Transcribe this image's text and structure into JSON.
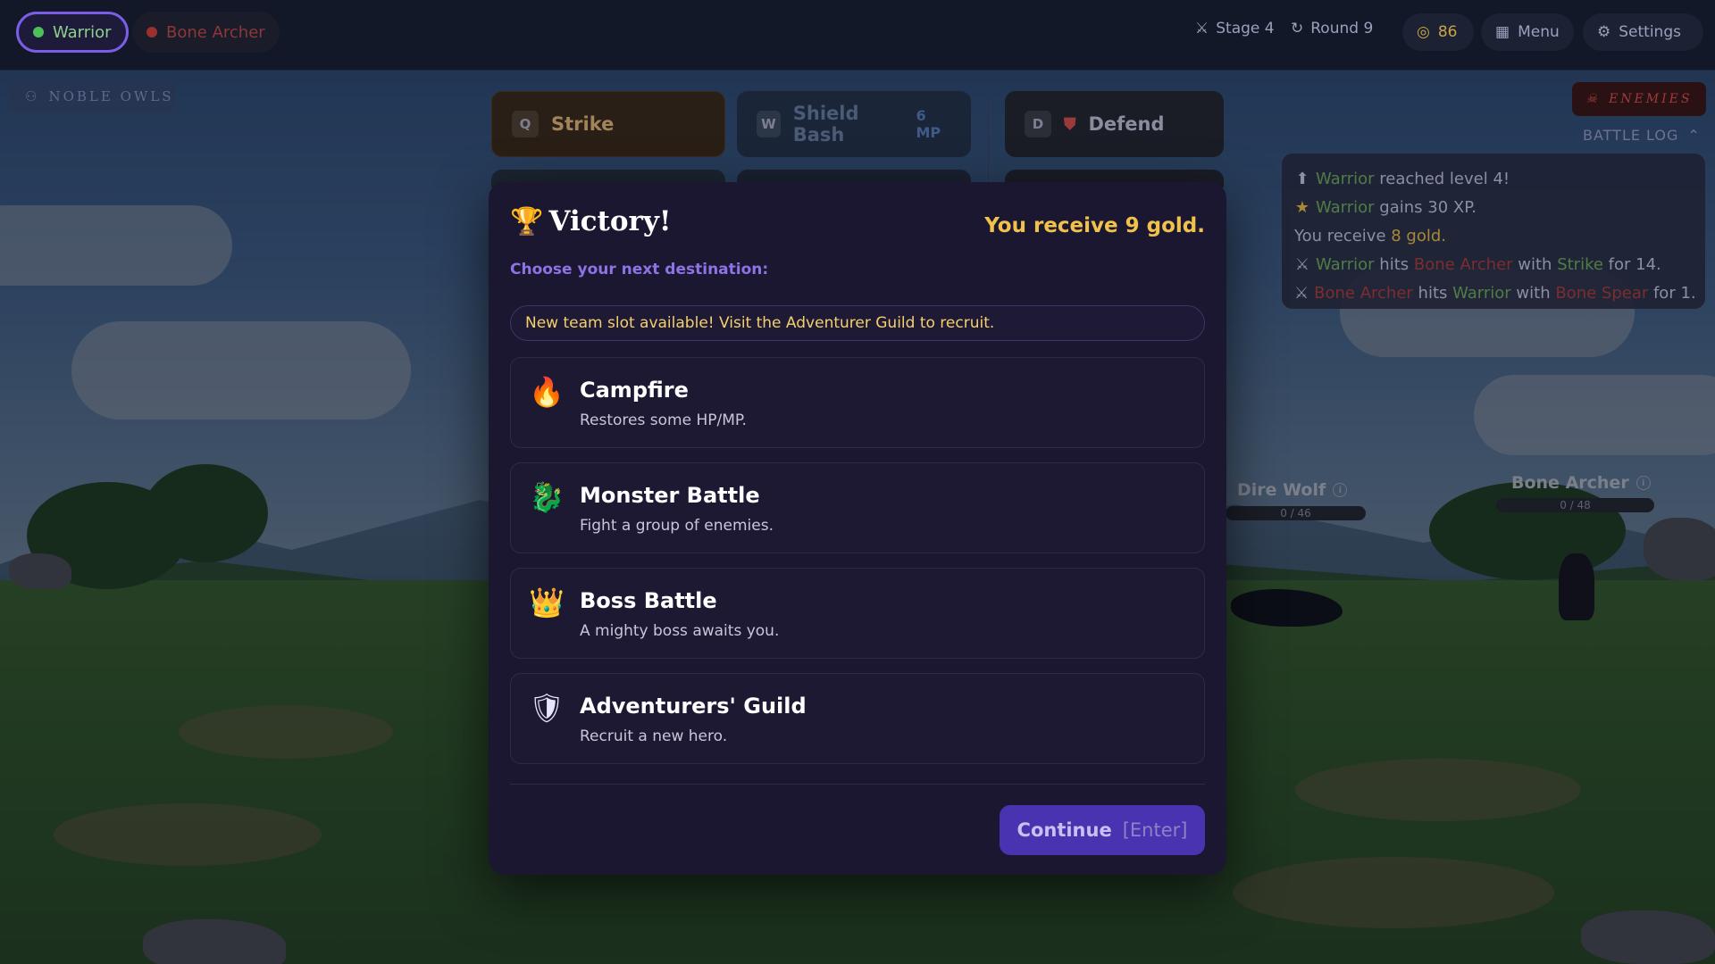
{
  "party": [
    {
      "name": "Warrior",
      "color": "#4fbf5a",
      "active": true
    },
    {
      "name": "Bone Archer",
      "color": "#b03a3a",
      "active": false
    }
  ],
  "status": {
    "stage": "Stage 4",
    "round": "Round 9",
    "gold": "86",
    "menu_label": "Menu",
    "settings_label": "Settings"
  },
  "team_name": "NOBLE OWLS",
  "skills": [
    {
      "key": "Q",
      "name": "Strike",
      "cost": ""
    },
    {
      "key": "W",
      "name": "Shield Bash",
      "cost": "6 MP"
    },
    {
      "key": "D",
      "name": "Defend",
      "cost": ""
    }
  ],
  "enemies_label": "ENEMIES",
  "battle_log": {
    "title": "BATTLE LOG",
    "lines": [
      {
        "icon": "level-up-icon",
        "parts": [
          [
            "Warrior",
            "green"
          ],
          [
            " reached level 4!",
            ""
          ]
        ]
      },
      {
        "icon": "star-icon",
        "parts": [
          [
            "Warrior",
            "green"
          ],
          [
            " gains 30 XP.",
            ""
          ]
        ]
      },
      {
        "icon": "",
        "parts": [
          [
            "You receive ",
            ""
          ],
          [
            "8 gold.",
            "gold"
          ]
        ]
      },
      {
        "icon": "swords-icon",
        "parts": [
          [
            "Warrior",
            "green"
          ],
          [
            " hits ",
            ""
          ],
          [
            "Bone Archer",
            "red"
          ],
          [
            " with ",
            ""
          ],
          [
            "Strike",
            "green"
          ],
          [
            " for 14.",
            ""
          ]
        ]
      },
      {
        "icon": "swords-icon",
        "parts": [
          [
            "Bone Archer",
            "red"
          ],
          [
            " hits ",
            ""
          ],
          [
            "Warrior",
            "green"
          ],
          [
            " with ",
            ""
          ],
          [
            "Bone Spear",
            "red"
          ],
          [
            " for 1.",
            ""
          ]
        ]
      }
    ]
  },
  "enemy_units": [
    {
      "name": "Dire Wolf",
      "hp": "0 / 46"
    },
    {
      "name": "Bone Archer",
      "hp": "0 / 48"
    }
  ],
  "modal": {
    "title": "Victory!",
    "gold_message": "You receive 9 gold.",
    "subtitle": "Choose your next destination:",
    "notice": "New team slot available! Visit the Adventurer Guild to recruit.",
    "options": [
      {
        "icon": "campfire-icon",
        "glyph": "🔥",
        "name": "Campfire",
        "desc": "Restores some HP/MP."
      },
      {
        "icon": "monster-icon",
        "glyph": "🐉",
        "name": "Monster Battle",
        "desc": "Fight a group of enemies."
      },
      {
        "icon": "crown-icon",
        "glyph": "👑",
        "name": "Boss Battle",
        "desc": "A mighty boss awaits you."
      },
      {
        "icon": "shield-icon",
        "glyph": "🛡",
        "name": "Adventurers' Guild",
        "desc": "Recruit a new hero."
      }
    ],
    "continue_label": "Continue",
    "continue_hint": "[Enter]"
  },
  "colors": {
    "accent": "#4a33b0",
    "gold": "#f0c14b",
    "modal_bg": "#1b1730"
  }
}
